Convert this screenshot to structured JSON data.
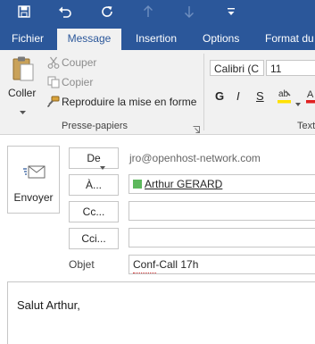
{
  "ribbon_tabs": [
    {
      "label": "Fichier",
      "active": false
    },
    {
      "label": "Message",
      "active": true
    },
    {
      "label": "Insertion",
      "active": false
    },
    {
      "label": "Options",
      "active": false
    },
    {
      "label": "Format du",
      "active": false
    }
  ],
  "clipboard": {
    "paste_label": "Coller",
    "cut_label": "Couper",
    "copy_label": "Copier",
    "format_painter_label": "Reproduire la mise en forme",
    "group_label": "Presse-papiers"
  },
  "font": {
    "name": "Calibri (C",
    "size": "11",
    "bold": "G",
    "italic": "I",
    "underline": "S",
    "group_label": "Text"
  },
  "compose": {
    "send_label": "Envoyer",
    "from_button": "De",
    "from_value": "jro@openhost-network.com",
    "to_button": "À...",
    "to_recipient": "Arthur GERARD",
    "to_suffix": ";",
    "cc_button": "Cc...",
    "bcc_button": "Cci...",
    "subject_label": "Objet",
    "subject_value": "Conf-Call 17h",
    "body_text": "Salut Arthur,"
  },
  "colors": {
    "brand": "#2b579a",
    "recipient_presence": "#5db85c"
  }
}
